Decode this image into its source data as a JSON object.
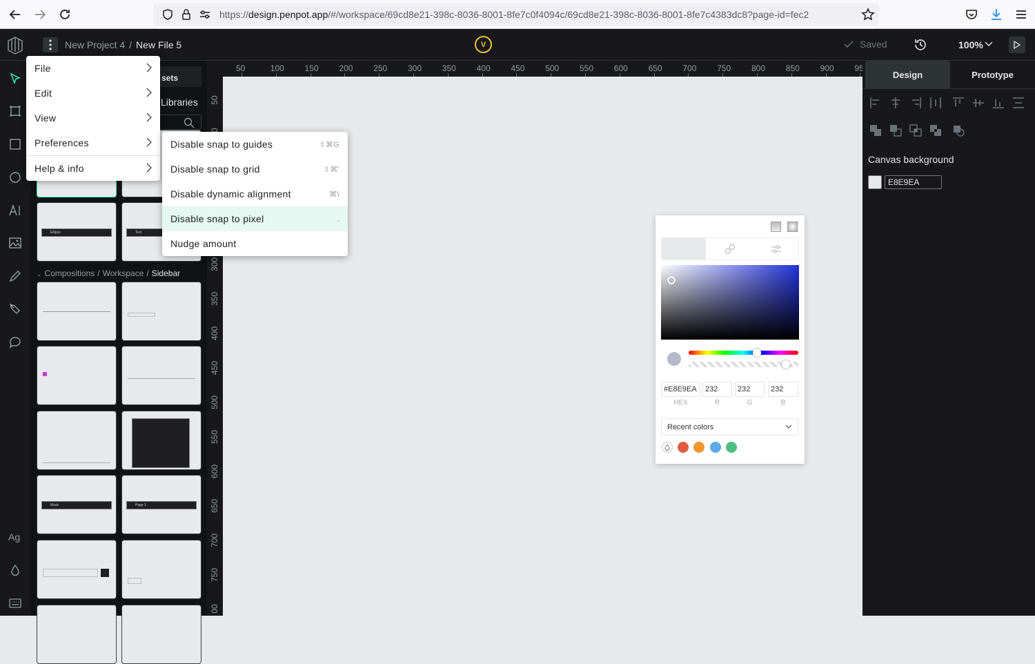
{
  "browser": {
    "url_host": "design.penpot.app",
    "url_prefix": "https://",
    "url_rest": "/#/workspace/69cd8e21-398c-8036-8001-8fe7c0f4094c/69cd8e21-398c-8036-8001-8fe7c4383dc8?page-id=fec2"
  },
  "topbar": {
    "project": "New Project 4",
    "separator": "/",
    "file": "New File 5",
    "user_initial": "V",
    "saved_label": "Saved",
    "zoom": "100%"
  },
  "assets": {
    "tab_fragment": "sets",
    "libraries_fragment": "Libraries",
    "section_path": [
      "Compositions",
      "Workspace",
      "Sidebar"
    ],
    "thumb_ellipse": "Ellipse",
    "thumb_text": "Text",
    "thumb_mask": "Mask",
    "thumb_page": "Page 1"
  },
  "ruler_top": [
    "50",
    "100",
    "150",
    "200",
    "250",
    "300",
    "350",
    "400",
    "450",
    "500",
    "550",
    "600",
    "650",
    "700",
    "750",
    "800",
    "850",
    "900",
    "95"
  ],
  "ruler_left": [
    "50",
    "00",
    "300",
    "350",
    "400",
    "450",
    "500",
    "550",
    "600",
    "650",
    "700",
    "750",
    "00"
  ],
  "right_panel": {
    "tab_design": "Design",
    "tab_prototype": "Prototype",
    "canvas_bg_label": "Canvas background",
    "canvas_bg_value": "E8E9EA",
    "canvas_bg_color": "#e8e9ea"
  },
  "main_menu": {
    "items": [
      {
        "label": "File"
      },
      {
        "label": "Edit"
      },
      {
        "label": "View"
      },
      {
        "label": "Preferences"
      },
      {
        "label": "Help & info"
      }
    ]
  },
  "preferences_submenu": {
    "items": [
      {
        "label": "Disable snap to guides",
        "shortcut": "⇧⌘G"
      },
      {
        "label": "Disable snap to grid",
        "shortcut": "⇧⌘'"
      },
      {
        "label": "Disable dynamic alignment",
        "shortcut": "⌘\\"
      },
      {
        "label": "Disable snap to pixel",
        "shortcut": ","
      },
      {
        "label": "Nudge amount",
        "shortcut": ""
      }
    ]
  },
  "color_picker": {
    "hex": "#E8E9EA",
    "r": "232",
    "g": "232",
    "b": "232",
    "hex_label": "HEX",
    "r_label": "R",
    "g_label": "G",
    "b_label": "B",
    "recent_label": "Recent colors",
    "recent_colors": [
      "#e05d44",
      "#f0962f",
      "#5ea9e6",
      "#4dbf82"
    ]
  },
  "colors": {
    "accent": "#31efb8",
    "topbar_bg": "#18181a",
    "panel_bg": "#111213",
    "menu_highlight": "#e6f8f2"
  }
}
